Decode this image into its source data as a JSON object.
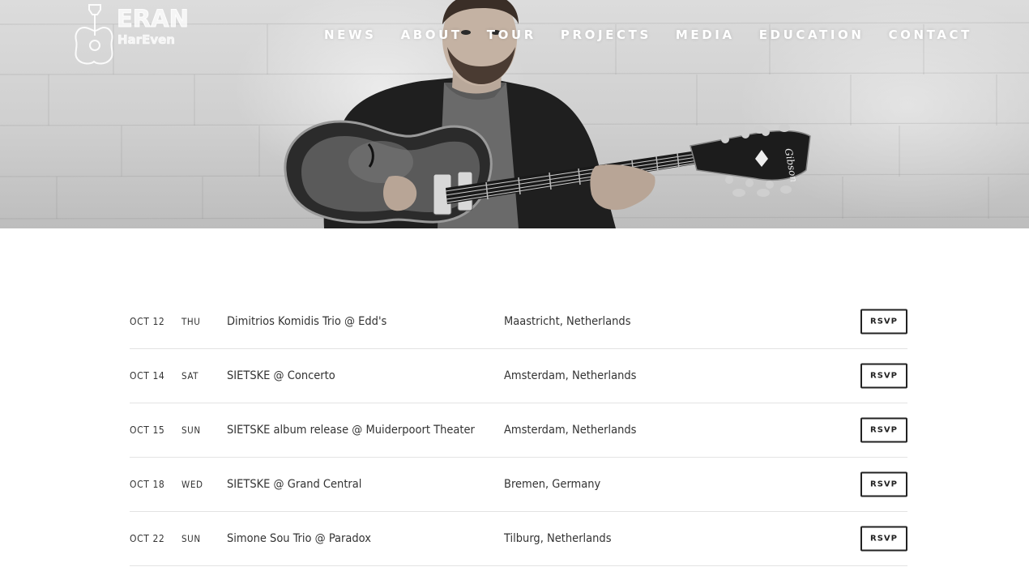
{
  "brand": {
    "line1": "ERAN",
    "line2": "HarEven"
  },
  "nav": {
    "items": [
      "NEWS",
      "ABOUT",
      "TOUR",
      "PROJECTS",
      "MEDIA",
      "EDUCATION",
      "CONTACT"
    ]
  },
  "hero": {
    "guitar_brand": "Gibson"
  },
  "tour": {
    "rsvp_label": "RSVP",
    "events": [
      {
        "date": "OCT 12",
        "day": "THU",
        "title": "Dimitrios Komidis Trio @ Edd's",
        "location": "Maastricht, Netherlands"
      },
      {
        "date": "OCT 14",
        "day": "SAT",
        "title": "SIETSKE @ Concerto",
        "location": "Amsterdam, Netherlands"
      },
      {
        "date": "OCT 15",
        "day": "SUN",
        "title": "SIETSKE album release @ Muiderpoort Theater",
        "location": "Amsterdam, Netherlands"
      },
      {
        "date": "OCT 18",
        "day": "WED",
        "title": "SIETSKE @ Grand Central",
        "location": "Bremen, Germany"
      },
      {
        "date": "OCT 22",
        "day": "SUN",
        "title": "Simone Sou Trio @ Paradox",
        "location": "Tilburg, Netherlands"
      }
    ]
  }
}
